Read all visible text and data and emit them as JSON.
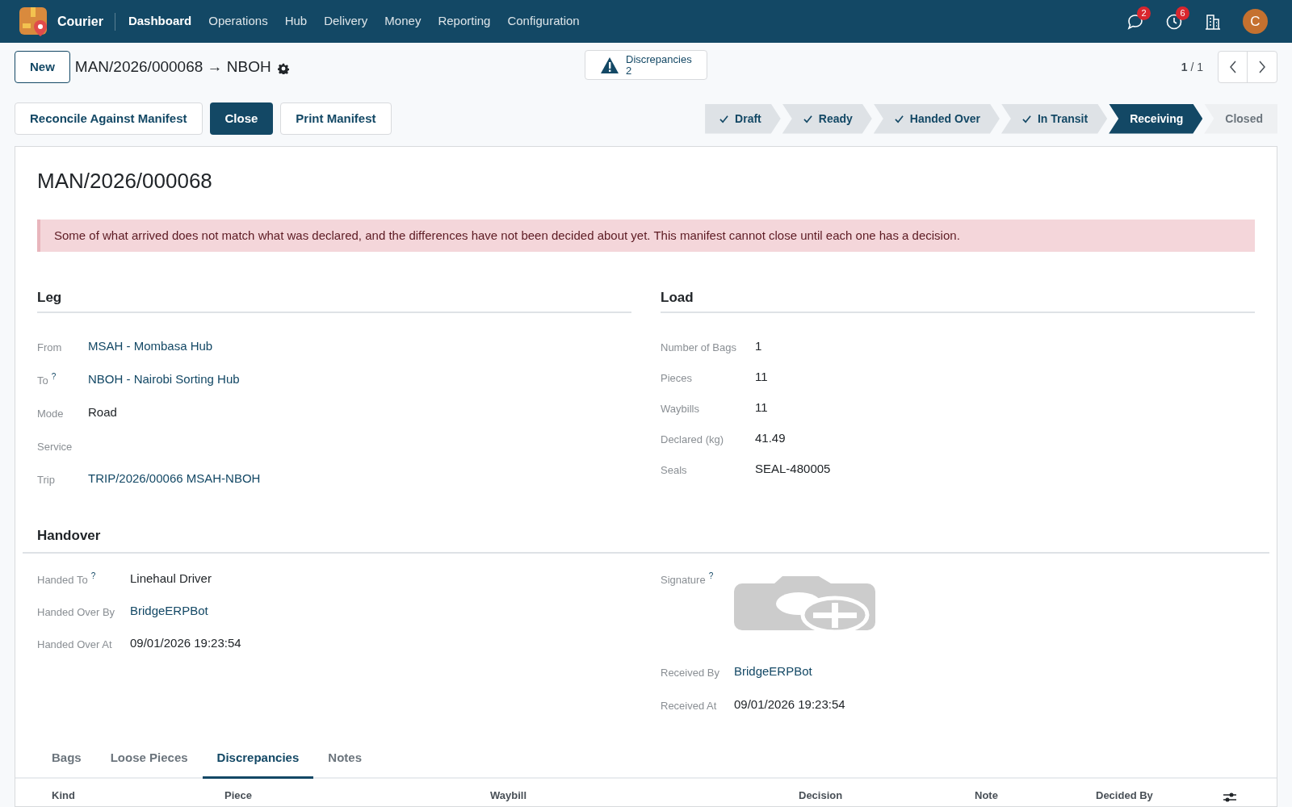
{
  "navbar": {
    "app_name": "Courier",
    "menu": [
      {
        "label": "Dashboard",
        "selected": true
      },
      {
        "label": "Operations",
        "selected": false
      },
      {
        "label": "Hub",
        "selected": false
      },
      {
        "label": "Delivery",
        "selected": false
      },
      {
        "label": "Money",
        "selected": false
      },
      {
        "label": "Reporting",
        "selected": false
      },
      {
        "label": "Configuration",
        "selected": false
      }
    ],
    "messages_badge": "2",
    "activities_badge": "6",
    "avatar_initial": "C"
  },
  "control_panel": {
    "new_button": "New",
    "breadcrumb": "MAN/2026/000068 → NBOH",
    "smart_button": {
      "label": "Discrepancies",
      "count": "2"
    },
    "pager": "**1** / 1"
  },
  "action_buttons": [
    {
      "label": "Reconcile Against Manifest",
      "kind": "secondary"
    },
    {
      "label": "Close",
      "kind": "primary"
    },
    {
      "label": "Print Manifest",
      "kind": "secondary"
    }
  ],
  "statusbar": [
    {
      "label": "Draft",
      "done": true,
      "selected": false
    },
    {
      "label": "Ready",
      "done": true,
      "selected": false
    },
    {
      "label": "Handed Over",
      "done": true,
      "selected": false
    },
    {
      "label": "In Transit",
      "done": true,
      "selected": false
    },
    {
      "label": "Receiving",
      "done": false,
      "selected": true
    },
    {
      "label": "Closed",
      "done": false,
      "selected": false
    }
  ],
  "sheet": {
    "title": "MAN/2026/000068",
    "alert": "Some of what arrived does not match what was declared, and the differences have not been decided about yet. This manifest cannot close until each one has a decision.",
    "leg": {
      "title": "Leg",
      "fields": [
        {
          "label": "From",
          "value": "MSAH - Mombasa Hub",
          "kind": "link"
        },
        {
          "label": "To",
          "help": "?",
          "value": "NBOH - Nairobi Sorting Hub",
          "kind": "link"
        },
        {
          "label": "Mode",
          "value": "Road",
          "kind": "text"
        },
        {
          "label": "Service",
          "kind": "text"
        },
        {
          "label": "Trip",
          "value": "TRIP/2026/00066 MSAH-NBOH",
          "kind": "link"
        }
      ]
    },
    "load": {
      "title": "Load",
      "fields": [
        {
          "label": "Number of Bags",
          "value": "1",
          "kind": "text"
        },
        {
          "label": "Pieces",
          "value": "11",
          "kind": "text"
        },
        {
          "label": "Waybills",
          "value": "11",
          "kind": "text"
        },
        {
          "label": "Declared (kg)",
          "value": "41.49",
          "kind": "text"
        },
        {
          "label": "Seals",
          "value": "SEAL-480005",
          "kind": "text"
        }
      ]
    },
    "handover": {
      "title": "Handover",
      "left_fields": [
        {
          "label": "Handed To",
          "help": "?",
          "value": "Linehaul Driver",
          "kind": "text"
        },
        {
          "label": "Handed Over By",
          "value": "BridgeERPBot",
          "kind": "link"
        },
        {
          "label": "Handed Over At",
          "value": "09/01/2026 19:23:54",
          "kind": "text"
        }
      ],
      "right_fields": [
        {
          "label": "Signature",
          "help": "?",
          "kind": "image"
        },
        {
          "label": "Received By",
          "value": "BridgeERPBot",
          "kind": "link"
        },
        {
          "label": "Received At",
          "value": "09/01/2026 19:23:54",
          "kind": "text"
        }
      ]
    },
    "tabs": [
      {
        "label": "Bags",
        "selected": false
      },
      {
        "label": "Loose Pieces",
        "selected": false
      },
      {
        "label": "Discrepancies",
        "selected": true
      },
      {
        "label": "Notes",
        "selected": false
      }
    ],
    "table": {
      "columns": [
        "Kind",
        "Piece",
        "Waybill",
        "Decision",
        "Note",
        "Decided By"
      ]
    }
  }
}
